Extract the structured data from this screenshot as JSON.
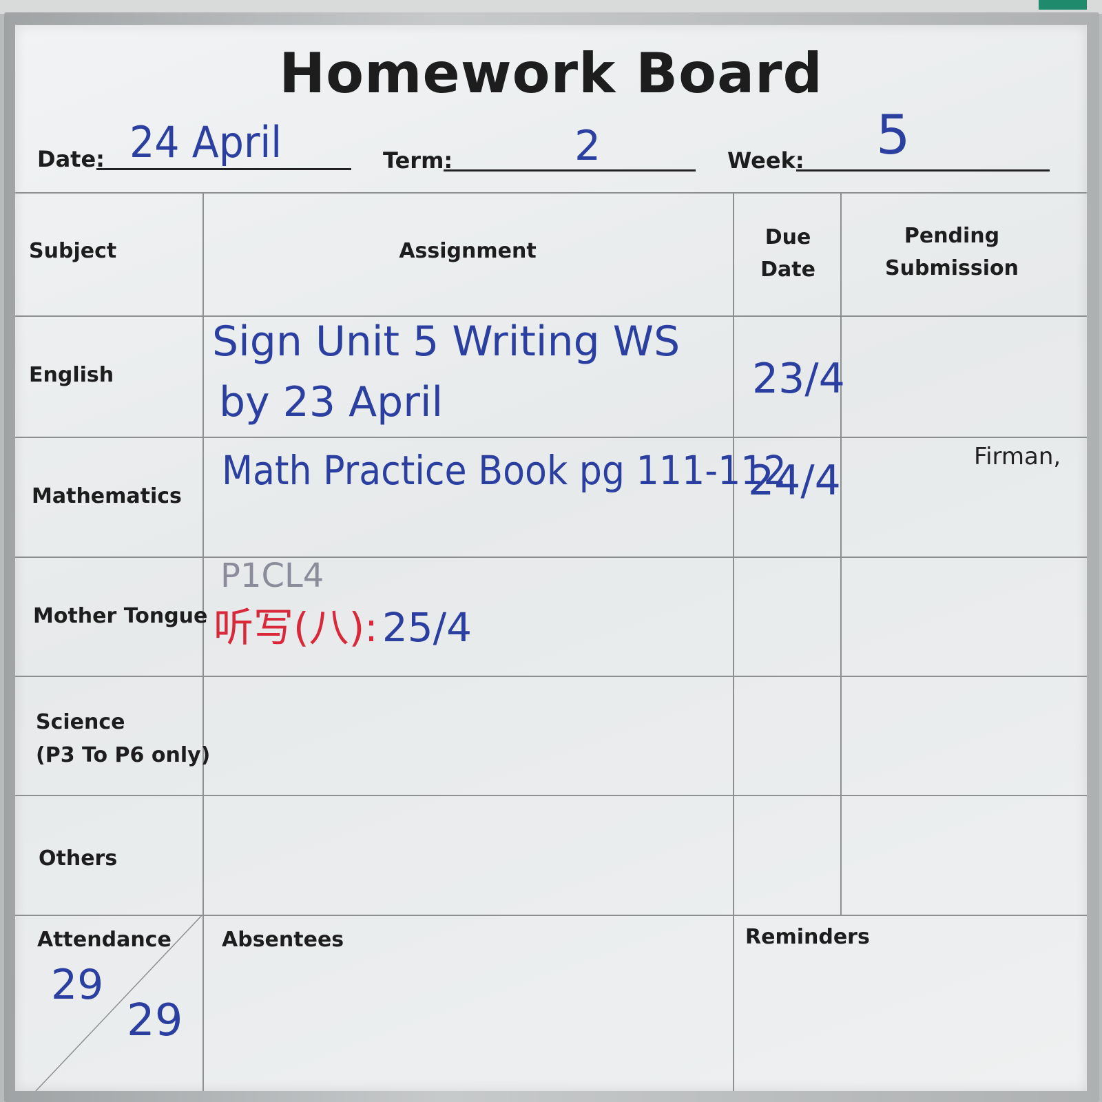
{
  "board": {
    "title": "Homework Board",
    "date_label": "Date:",
    "date_value": "24 April",
    "term_label": "Term:",
    "term_value": "2",
    "week_label": "Week:",
    "week_value": "5"
  },
  "table": {
    "headers": {
      "subject": "Subject",
      "assignment": "Assignment",
      "due_date": "Due Date",
      "pending": "Pending Submission"
    },
    "rows": [
      {
        "subject": "English",
        "assignment": [
          "Sign Unit 5 Writing WS",
          "by 23 April"
        ],
        "due": "23/4",
        "pending": ""
      },
      {
        "subject": "Mathematics",
        "assignment": [
          "Math Practice Book pg 111-112"
        ],
        "due": "24/4",
        "pending": "Firman,"
      },
      {
        "subject": "Mother Tongue",
        "assignment_note": "P1CL4",
        "assignment_red": "听写(八)",
        "assignment_colon": ":",
        "assignment_blue": "25/4",
        "due": "",
        "pending": ""
      },
      {
        "subject": "Science",
        "subject_note": "(P3 To P6 only)",
        "assignment": [],
        "due": "",
        "pending": ""
      },
      {
        "subject": "Others",
        "assignment": [],
        "due": "",
        "pending": ""
      }
    ],
    "footer": {
      "attendance_label": "Attendance",
      "attendance_present": "29",
      "attendance_total": "29",
      "absentees_label": "Absentees",
      "reminders_label": "Reminders"
    }
  },
  "colors": {
    "marker_blue": "#2a3fa0",
    "marker_red": "#d8283a",
    "marker_grey": "#8a8c99",
    "marker_black": "#222222"
  }
}
